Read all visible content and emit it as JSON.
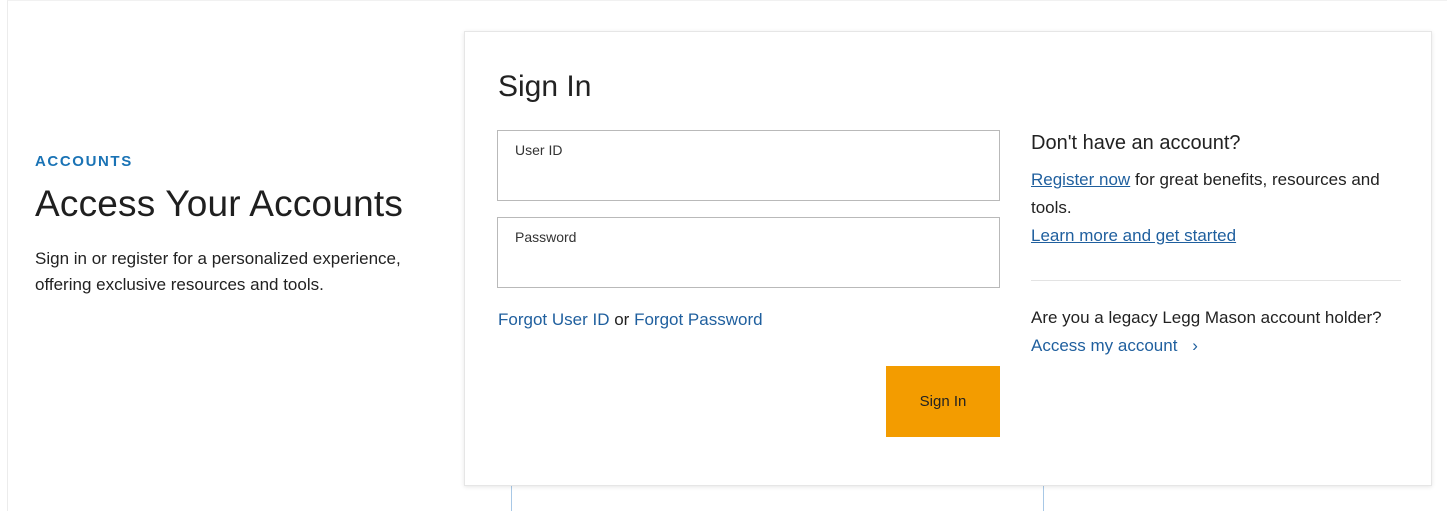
{
  "intro": {
    "eyebrow": "ACCOUNTS",
    "title": "Access Your Accounts",
    "description": "Sign in or register for a personalized experience, offering exclusive resources and tools."
  },
  "signin": {
    "title": "Sign In",
    "user_id_label": "User ID",
    "user_id_value": "",
    "password_label": "Password",
    "password_value": "",
    "forgot_user_id": "Forgot User ID",
    "forgot_or": "or",
    "forgot_password": "Forgot Password",
    "button_label": "Sign In"
  },
  "register": {
    "heading": "Don't have an account?",
    "register_link": "Register now",
    "register_text": "for great benefits, resources and tools.",
    "learn_more": "Learn more and get started"
  },
  "legacy": {
    "text": "Are you a legacy Legg Mason account holder?",
    "access_link": "Access my account",
    "chevron_icon": "chevron-right-icon"
  },
  "colors": {
    "accent_blue": "#1a73b5",
    "link_blue": "#1f5f9e",
    "button_orange": "#f39c00"
  }
}
